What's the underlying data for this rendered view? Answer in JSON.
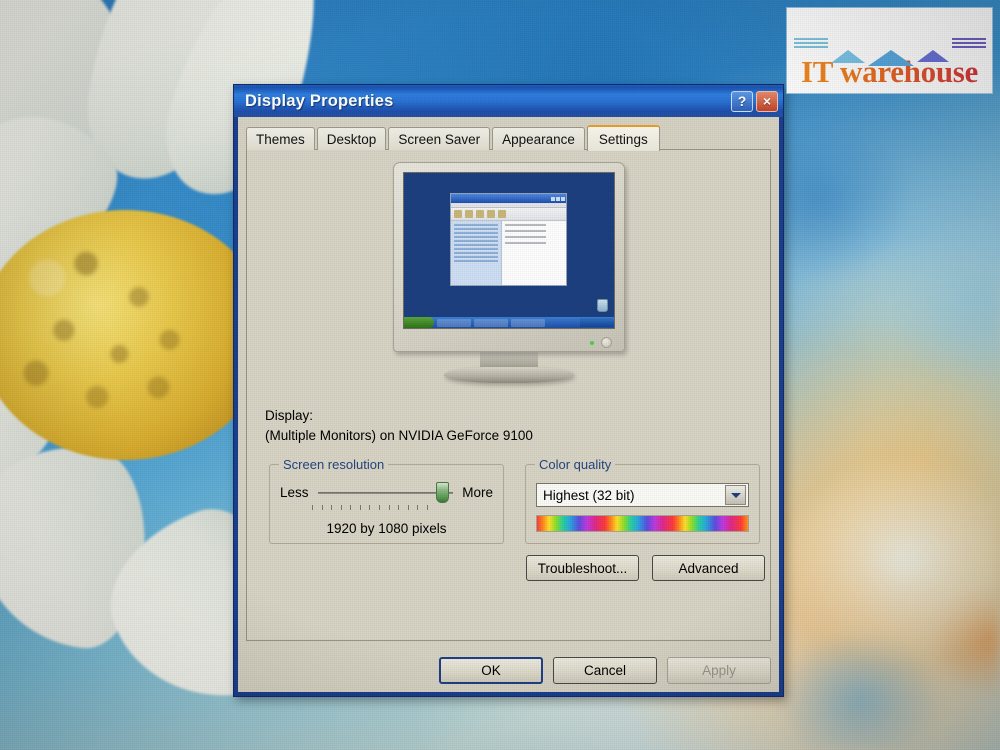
{
  "window": {
    "title": "Display Properties",
    "help_button": "?",
    "close_button": "×"
  },
  "tabs": [
    {
      "label": "Themes",
      "active": false
    },
    {
      "label": "Desktop",
      "active": false
    },
    {
      "label": "Screen Saver",
      "active": false
    },
    {
      "label": "Appearance",
      "active": false
    },
    {
      "label": "Settings",
      "active": true
    }
  ],
  "settings": {
    "display_label": "Display:",
    "display_value": "(Multiple Monitors) on NVIDIA GeForce 9100",
    "screen_resolution": {
      "legend": "Screen resolution",
      "less_label": "Less",
      "more_label": "More",
      "value_text": "1920 by 1080 pixels",
      "slider_position_percent": 88
    },
    "color_quality": {
      "legend": "Color quality",
      "selected": "Highest (32 bit)"
    },
    "troubleshoot_button": "Troubleshoot...",
    "advanced_button": "Advanced"
  },
  "footer": {
    "ok": "OK",
    "cancel": "Cancel",
    "apply": "Apply"
  },
  "logo": {
    "wordmark": "IT warehouse"
  },
  "colors": {
    "titlebar_blue": "#2a72d4",
    "dialog_frame": "#1b3f8f",
    "dialog_face": "#d6d3c4",
    "active_tab_accent": "#e39b28",
    "legend_text": "#26457f",
    "slider_thumb_green": "#5d9a55",
    "close_button_red": "#c1452a",
    "logo_orange": "#f08a21",
    "logo_red": "#d6353a",
    "wallpaper_blue": "#2d7ec2",
    "daisy_yellow": "#e9c94c"
  }
}
